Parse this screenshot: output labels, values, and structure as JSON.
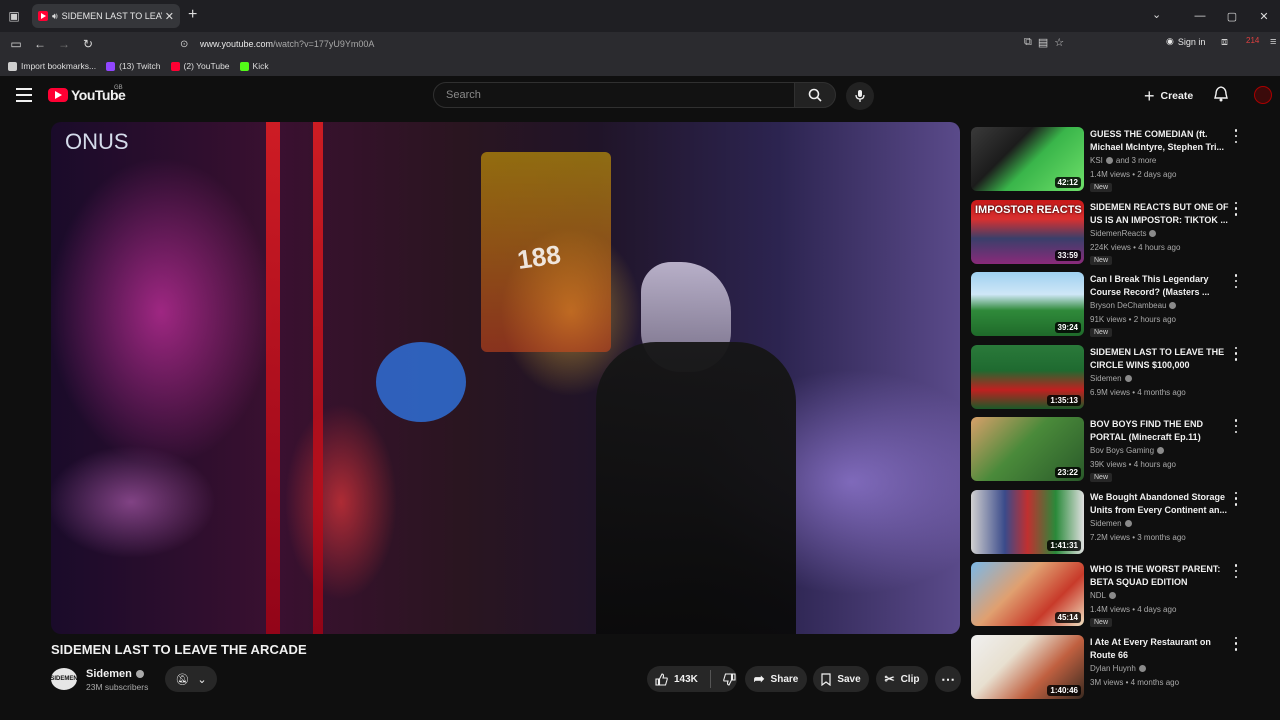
{
  "browser": {
    "tab_title": "SIDEMEN LAST TO LEAVE THE ARCADE",
    "url_host": "www.youtube.com",
    "url_path": "/watch?v=177yU9Ym00A",
    "signin_label": "Sign in",
    "extension_badge": "214"
  },
  "bookmarks": [
    {
      "label": "Import bookmarks...",
      "color": "#cfcfcf"
    },
    {
      "label": "(13) Twitch",
      "color": "#9146ff"
    },
    {
      "label": "(2) YouTube",
      "color": "#ff0033"
    },
    {
      "label": "Kick",
      "color": "#53fc18"
    }
  ],
  "yt": {
    "logo_text": "YouTube",
    "country": "GB",
    "search_placeholder": "Search",
    "create_label": "Create"
  },
  "player": {
    "overlay_bonus": "ONUS",
    "overlay_188": "188"
  },
  "video": {
    "title": "SIDEMEN LAST TO LEAVE THE ARCADE",
    "channel": "Sidemen",
    "channel_avatar_text": "SIDEMEN",
    "subscribers": "23M subscribers",
    "likes": "143K",
    "share_label": "Share",
    "save_label": "Save",
    "clip_label": "Clip"
  },
  "sidebar": [
    {
      "title": "GUESS THE COMEDIAN (ft. Michael McIntyre, Stephen Tri...",
      "channel": "KSI",
      "channel_extra": "and 3 more",
      "meta": "1.4M views • 2 days ago",
      "duration": "42:12",
      "is_new": true,
      "new_label": "New",
      "thumb_caption": "",
      "thumb_bg": "linear-gradient(135deg,#3a3a3a 0%,#1c1c1c 35%,#39b54a 55%,#6fe06a 100%)"
    },
    {
      "title": "SIDEMEN REACTS BUT ONE OF US IS AN IMPOSTOR: TIKTOK ...",
      "channel": "SidemenReacts",
      "channel_extra": "",
      "meta": "224K views • 4 hours ago",
      "duration": "33:59",
      "is_new": true,
      "new_label": "New",
      "thumb_caption": "IMPOSTOR REACTS",
      "thumb_bg": "linear-gradient(180deg,#c81818 0%,#d83030 30%,#3a3f6a 60%,#8a2a7a 100%)"
    },
    {
      "title": "Can I Break This Legendary Course Record? (Masters ...",
      "channel": "Bryson DeChambeau",
      "channel_extra": "",
      "meta": "91K views • 2 hours ago",
      "duration": "39:24",
      "is_new": true,
      "new_label": "New",
      "thumb_caption": "",
      "thumb_bg": "linear-gradient(180deg,#9fd0f0 0%,#cfe7f7 35%,#2f8a3a 60%,#1f6a2a 100%)"
    },
    {
      "title": "SIDEMEN LAST TO LEAVE THE CIRCLE WINS $100,000",
      "channel": "Sidemen",
      "channel_extra": "",
      "meta": "6.9M views • 4 months ago",
      "duration": "1:35:13",
      "is_new": false,
      "new_label": "",
      "thumb_caption": "",
      "thumb_bg": "linear-gradient(180deg,#2a7a3a 0%,#1f6a30 40%,#c02020 70%,#1a5a28 100%)"
    },
    {
      "title": "BOV BOYS FIND THE END PORTAL (Minecraft Ep.11)",
      "channel": "Bov Boys Gaming",
      "channel_extra": "",
      "meta": "39K views • 4 hours ago",
      "duration": "23:22",
      "is_new": true,
      "new_label": "New",
      "thumb_caption": "",
      "thumb_bg": "linear-gradient(135deg,#d8a06a 0%,#4a8a3a 45%,#2a5a2a 100%)"
    },
    {
      "title": "We Bought Abandoned Storage Units from Every Continent an...",
      "channel": "Sidemen",
      "channel_extra": "",
      "meta": "7.2M views • 3 months ago",
      "duration": "1:41:31",
      "is_new": false,
      "new_label": "",
      "thumb_caption": "",
      "thumb_bg": "linear-gradient(90deg,#d0d0d0 0%,#3a4a8a 30%,#c03030 50%,#2a8a3a 75%,#e0e0e0 100%)"
    },
    {
      "title": "WHO IS THE WORST PARENT: BETA SQUAD EDITION",
      "channel": "NDL",
      "channel_extra": "",
      "meta": "1.4M views • 4 days ago",
      "duration": "45:14",
      "is_new": true,
      "new_label": "New",
      "thumb_caption": "",
      "thumb_bg": "linear-gradient(135deg,#7ab8e8 0%,#e0a070 40%,#c83a2a 70%,#f0e0c0 100%)"
    },
    {
      "title": "I Ate At Every Restaurant on Route 66",
      "channel": "Dylan Huynh",
      "channel_extra": "",
      "meta": "3M views • 4 months ago",
      "duration": "1:40:46",
      "is_new": false,
      "new_label": "",
      "thumb_caption": "",
      "thumb_bg": "linear-gradient(135deg,#f0f0f0 0%,#e8e0d0 35%,#c06040 65%,#3a2a20 100%)"
    }
  ]
}
